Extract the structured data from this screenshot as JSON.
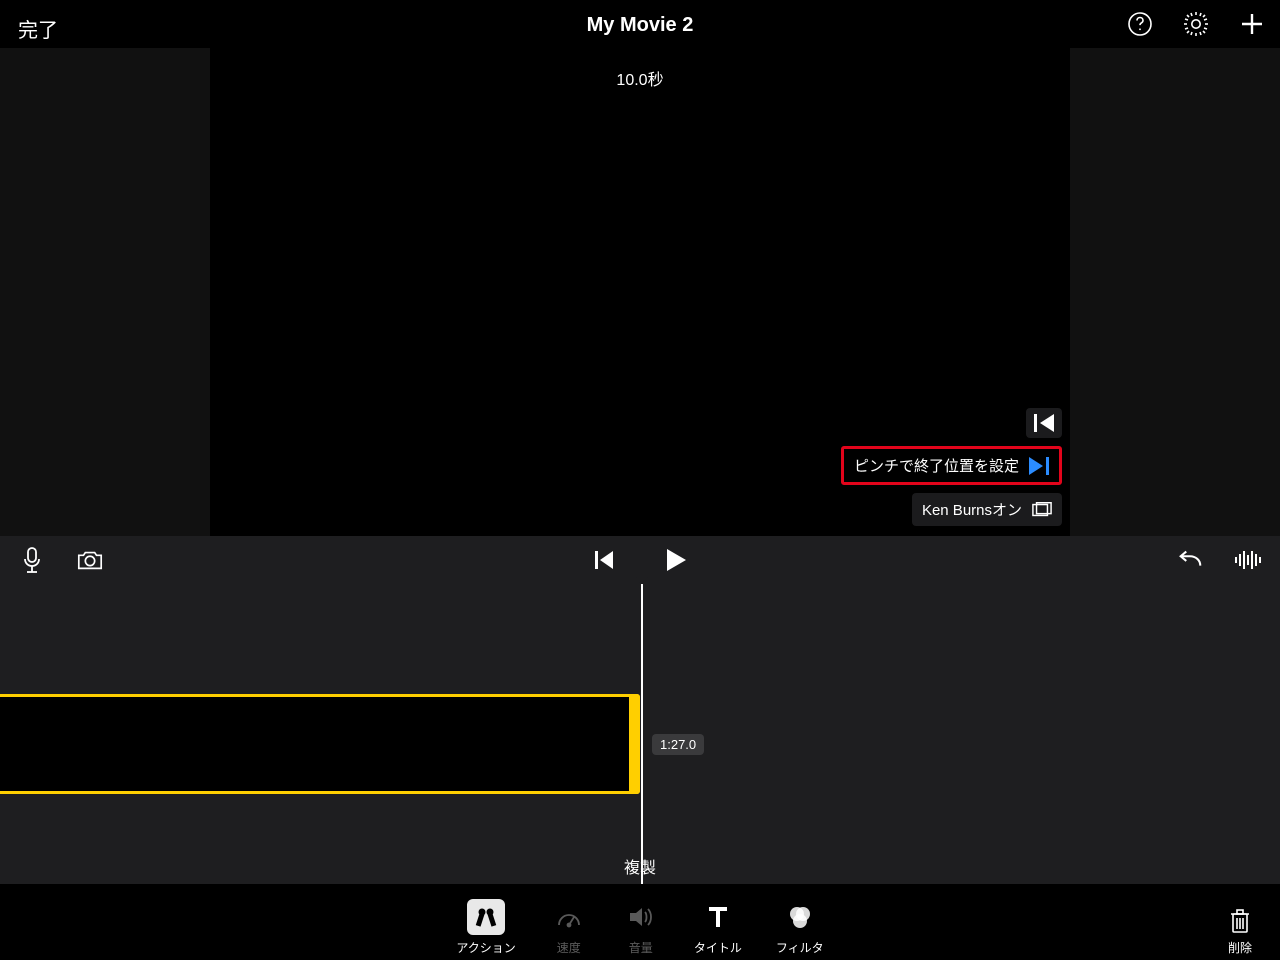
{
  "header": {
    "done": "完了",
    "title": "My Movie 2"
  },
  "preview": {
    "duration": "10.0秒",
    "pinch_label": "ピンチで終了位置を設定",
    "ken_burns": "Ken Burnsオン"
  },
  "timeline": {
    "time_label": "1:27.0"
  },
  "bottom": {
    "duplicate": "複製",
    "tools": {
      "action": "アクション",
      "speed": "速度",
      "volume": "音量",
      "title": "タイトル",
      "filter": "フィルタ"
    },
    "delete": "削除"
  }
}
